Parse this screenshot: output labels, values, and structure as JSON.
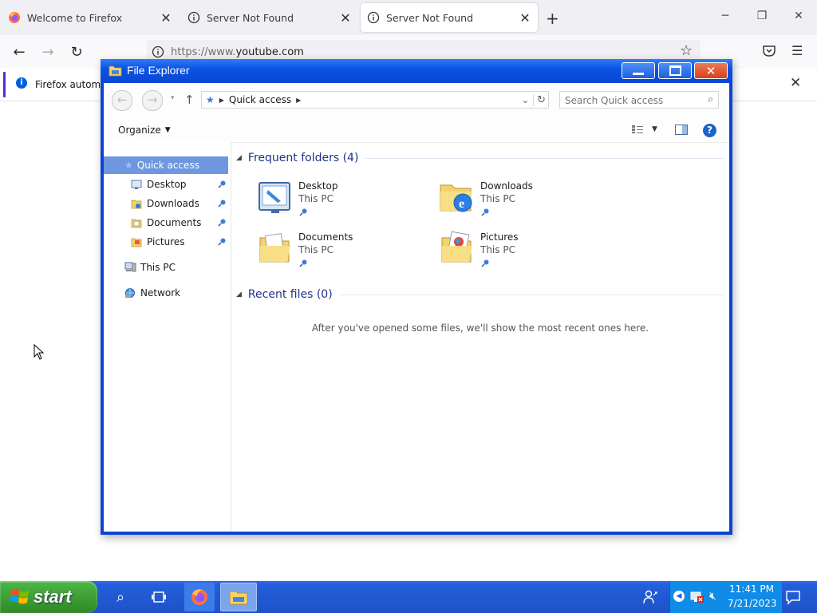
{
  "browser": {
    "tabs": [
      {
        "title": "Welcome to Firefox"
      },
      {
        "title": "Server Not Found"
      },
      {
        "title": "Server Not Found"
      }
    ],
    "url_prefix": "https://www.",
    "url_domain": "youtube.com",
    "notification_text": "Firefox automat"
  },
  "explorer": {
    "title": "File Explorer",
    "breadcrumb": "Quick access",
    "search_placeholder": "Search Quick access",
    "organize_label": "Organize",
    "nav": {
      "quick_access": "Quick access",
      "pinned": [
        {
          "label": "Desktop"
        },
        {
          "label": "Downloads"
        },
        {
          "label": "Documents"
        },
        {
          "label": "Pictures"
        }
      ],
      "this_pc": "This PC",
      "network": "Network"
    },
    "frequent_header": "Frequent folders (4)",
    "frequent": [
      {
        "name": "Desktop",
        "location": "This PC"
      },
      {
        "name": "Downloads",
        "location": "This PC"
      },
      {
        "name": "Documents",
        "location": "This PC"
      },
      {
        "name": "Pictures",
        "location": "This PC"
      }
    ],
    "recent_header": "Recent files (0)",
    "recent_empty": "After you've opened some files, we'll show the most recent ones here."
  },
  "taskbar": {
    "start_label": "start",
    "time": "11:41 PM",
    "date": "7/21/2023"
  },
  "colors": {
    "xp_blue": "#0a44d0",
    "start_green": "#3c9a32",
    "selection": "#6e97df",
    "group_header": "#1e3287"
  }
}
